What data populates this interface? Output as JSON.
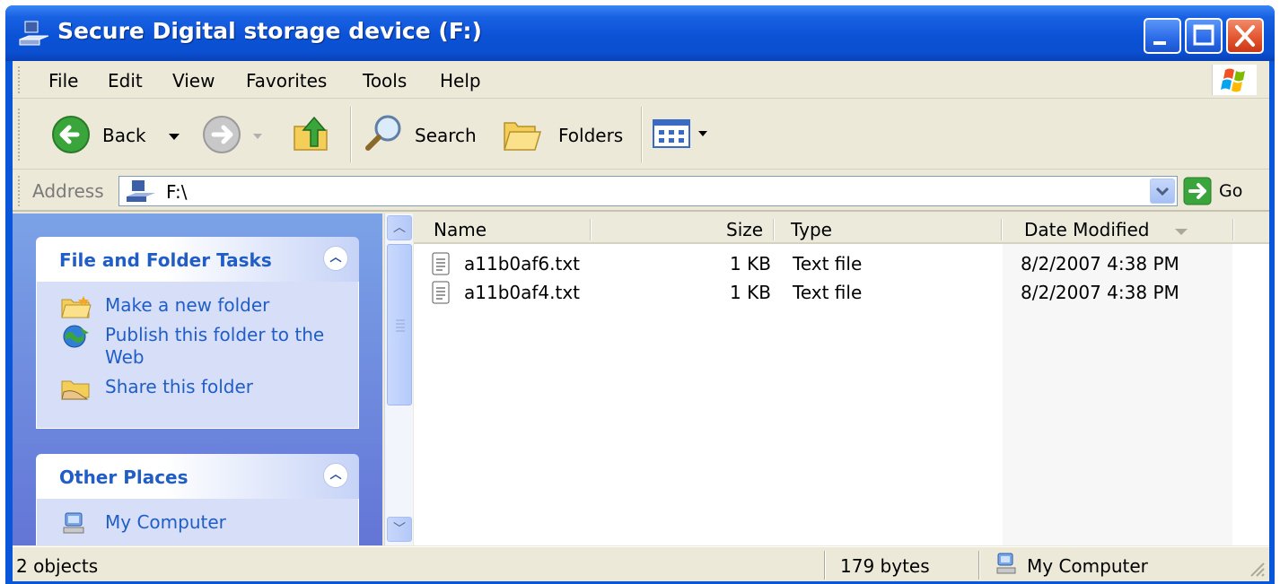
{
  "window": {
    "title": "Secure Digital storage device (F:)"
  },
  "menubar": {
    "items": [
      "File",
      "Edit",
      "View",
      "Favorites",
      "Tools",
      "Help"
    ]
  },
  "toolbar": {
    "back_label": "Back",
    "search_label": "Search",
    "folders_label": "Folders"
  },
  "address": {
    "label": "Address",
    "value": "F:\\",
    "go_label": "Go"
  },
  "taskpane": {
    "file_tasks": {
      "title": "File and Folder Tasks",
      "items": [
        {
          "label": "Make a new folder",
          "icon": "new-folder-icon"
        },
        {
          "label": "Publish this folder to the Web",
          "icon": "publish-web-icon"
        },
        {
          "label": "Share this folder",
          "icon": "share-folder-icon"
        }
      ]
    },
    "other_places": {
      "title": "Other Places",
      "items": [
        {
          "label": "My Computer",
          "icon": "my-computer-icon"
        }
      ]
    }
  },
  "filelist": {
    "columns": {
      "name": "Name",
      "size": "Size",
      "type": "Type",
      "date": "Date Modified"
    },
    "rows": [
      {
        "name": "a11b0af6.txt",
        "size": "1 KB",
        "type": "Text file",
        "date": "8/2/2007 4:38 PM"
      },
      {
        "name": "a11b0af4.txt",
        "size": "1 KB",
        "type": "Text file",
        "date": "8/2/2007 4:38 PM"
      }
    ]
  },
  "statusbar": {
    "objects": "2 objects",
    "size": "179 bytes",
    "zone": "My Computer"
  },
  "colors": {
    "title_blue": "#0a56d8",
    "task_link": "#215dc6",
    "chrome": "#ece9d8"
  }
}
